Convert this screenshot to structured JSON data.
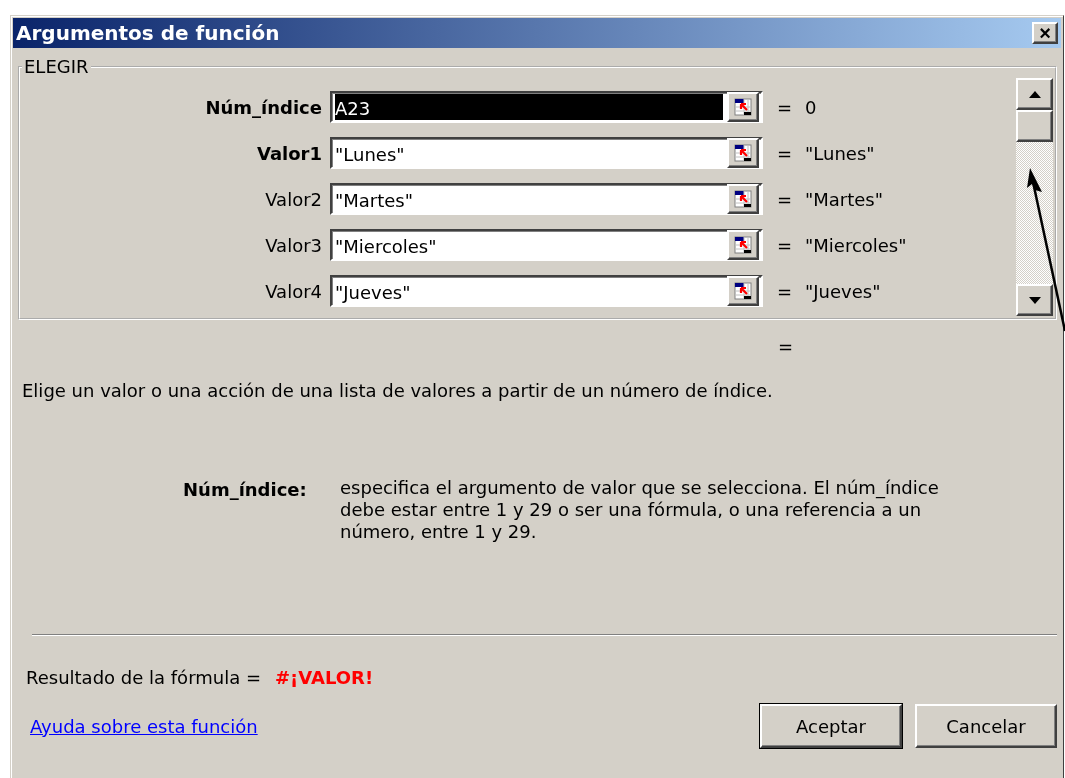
{
  "window": {
    "title": "Argumentos de función",
    "close": "×"
  },
  "group": {
    "title": "ELEGIR"
  },
  "arguments": [
    {
      "label": "Núm_índice",
      "value": "A23",
      "equals": "=",
      "result": "0",
      "required": true,
      "selected": true
    },
    {
      "label": "Valor1",
      "value": "\"Lunes\"",
      "equals": "=",
      "result": "\"Lunes\"",
      "required": true,
      "selected": false
    },
    {
      "label": "Valor2",
      "value": "\"Martes\"",
      "equals": "=",
      "result": "\"Martes\"",
      "required": false,
      "selected": false
    },
    {
      "label": "Valor3",
      "value": "\"Miercoles\"",
      "equals": "=",
      "result": "\"Miercoles\"",
      "required": false,
      "selected": false
    },
    {
      "label": "Valor4",
      "value": "\"Jueves\"",
      "equals": "=",
      "result": "\"Jueves\"",
      "required": false,
      "selected": false
    }
  ],
  "overall_result": "=",
  "description": "Elige un valor o una acción de una lista de valores a partir de un número de índice.",
  "argument_help": {
    "label": "Núm_índice:",
    "text": "especifica el argumento de valor que se selecciona. El núm_índice debe estar entre 1 y 29 o ser una fórmula, o una referencia a un número, entre 1 y 29."
  },
  "formula_result": {
    "label": "Resultado de la fórmula =",
    "value": "#¡VALOR!"
  },
  "help_link": "Ayuda sobre esta función",
  "buttons": [
    {
      "label": "Aceptar",
      "default": true
    },
    {
      "label": "Cancelar",
      "default": false
    }
  ]
}
